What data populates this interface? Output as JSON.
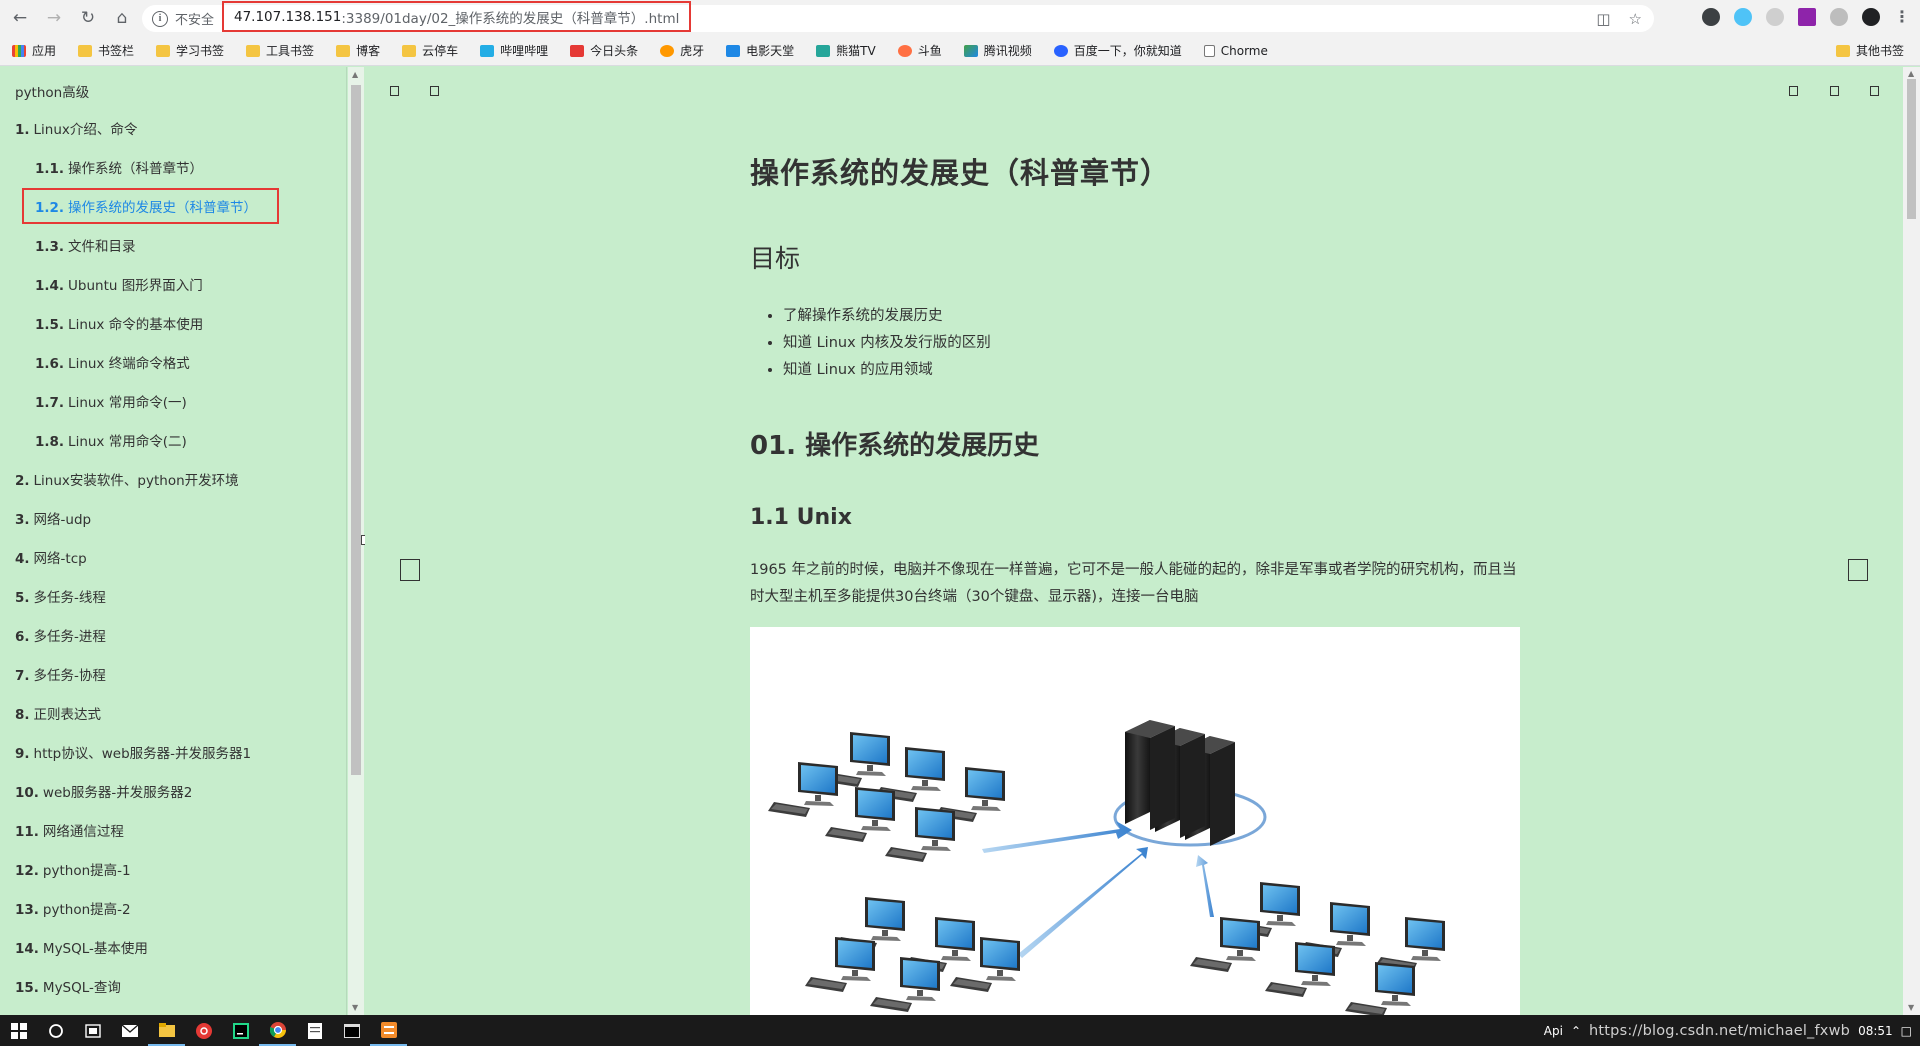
{
  "browser": {
    "insecure_label": "不安全",
    "url_host": "47.107.138.151",
    "url_path": ":3389/01day/02_操作系统的发展史（科普章节）.html",
    "bookmarks": [
      {
        "label": "应用",
        "icon": "apps-grid-icon"
      },
      {
        "label": "书签栏",
        "icon": "folder-icon"
      },
      {
        "label": "学习书签",
        "icon": "folder-icon"
      },
      {
        "label": "工具书签",
        "icon": "folder-icon"
      },
      {
        "label": "博客",
        "icon": "folder-icon"
      },
      {
        "label": "云停车",
        "icon": "folder-icon"
      },
      {
        "label": "哔哩哔哩",
        "icon": "bilibili-icon"
      },
      {
        "label": "今日头条",
        "icon": "toutiao-icon"
      },
      {
        "label": "虎牙",
        "icon": "huya-icon"
      },
      {
        "label": "电影天堂",
        "icon": "movie-icon"
      },
      {
        "label": "熊猫TV",
        "icon": "pandatv-icon"
      },
      {
        "label": "斗鱼",
        "icon": "douyu-icon"
      },
      {
        "label": "腾讯视频",
        "icon": "tencent-video-icon"
      },
      {
        "label": "百度一下，你就知道",
        "icon": "baidu-icon"
      },
      {
        "label": "Chorme",
        "icon": "page-icon"
      }
    ],
    "other_bookmarks": "其他书签"
  },
  "sidebar": {
    "title": "python高级",
    "items": [
      {
        "num": "1.",
        "label": "Linux介绍、命令"
      },
      {
        "num": "1.1.",
        "label": "操作系统（科普章节）"
      },
      {
        "num": "1.2.",
        "label": "操作系统的发展史（科普章节）"
      },
      {
        "num": "1.3.",
        "label": "文件和目录"
      },
      {
        "num": "1.4.",
        "label": "Ubuntu 图形界面入门"
      },
      {
        "num": "1.5.",
        "label": "Linux 命令的基本使用"
      },
      {
        "num": "1.6.",
        "label": "Linux 终端命令格式"
      },
      {
        "num": "1.7.",
        "label": "Linux 常用命令(一)"
      },
      {
        "num": "1.8.",
        "label": "Linux 常用命令(二)"
      },
      {
        "num": "2.",
        "label": "Linux安装软件、python开发环境"
      },
      {
        "num": "3.",
        "label": "网络-udp"
      },
      {
        "num": "4.",
        "label": "网络-tcp"
      },
      {
        "num": "5.",
        "label": "多任务-线程"
      },
      {
        "num": "6.",
        "label": "多任务-进程"
      },
      {
        "num": "7.",
        "label": "多任务-协程"
      },
      {
        "num": "8.",
        "label": "正则表达式"
      },
      {
        "num": "9.",
        "label": "http协议、web服务器-并发服务器1"
      },
      {
        "num": "10.",
        "label": "web服务器-并发服务器2"
      },
      {
        "num": "11.",
        "label": "网络通信过程"
      },
      {
        "num": "12.",
        "label": "python提高-1"
      },
      {
        "num": "13.",
        "label": "python提高-2"
      },
      {
        "num": "14.",
        "label": "MySQL-基本使用"
      },
      {
        "num": "15.",
        "label": "MySQL-查询"
      }
    ]
  },
  "main": {
    "title": "操作系统的发展史（科普章节）",
    "goals_heading": "目标",
    "goals": [
      "了解操作系统的发展历史",
      "知道 Linux 内核及发行版的区别",
      "知道 Linux 的应用领域"
    ],
    "section_heading": "01. 操作系统的发展历史",
    "subsection_heading": "1.1 Unix",
    "paragraph": "1965 年之前的时候，电脑并不像现在一样普遍，它可不是一般人能碰的起的，除非是军事或者学院的研究机构，而且当时大型主机至多能提供30台终端（30个键盘、显示器)，连接一台电脑"
  },
  "taskbar": {
    "tray_text": "Api",
    "watermark": "https://blog.csdn.net/michael_fxwb",
    "clock": "08:51"
  }
}
